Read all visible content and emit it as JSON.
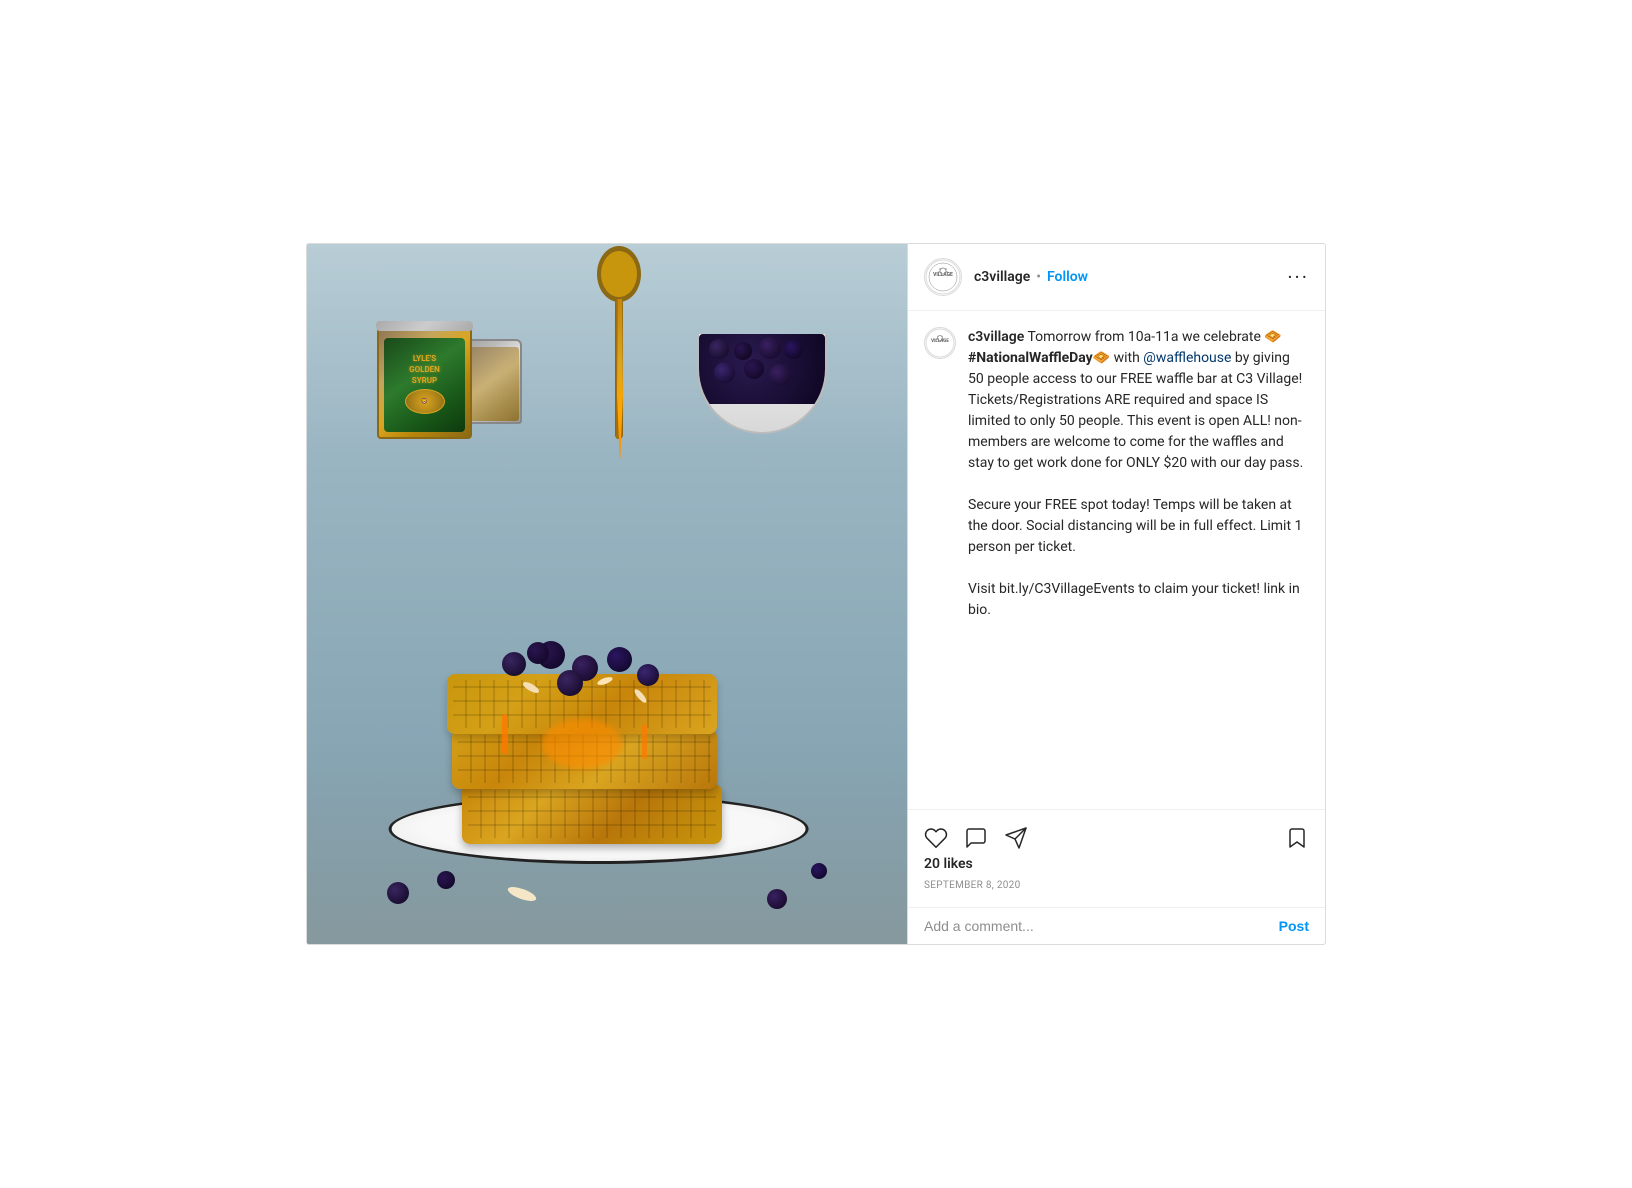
{
  "post": {
    "username": "c3village",
    "follow_label": "Follow",
    "dot_separator": "•",
    "more_icon": "•••",
    "avatar_text": "VILLAGE",
    "caption": {
      "username": "c3village",
      "text_part1": " Tomorrow from 10a-11a we celebrate 🧇#NationalWaffleDay🧇 with ",
      "mention": "@wafflehouse",
      "text_part2": " by giving 50 people access to our FREE waffle bar at C3 Village!\nTickets/Registrations ARE required and space IS limited to only 50 people. This event is open ALL! non-members are welcome to come for the waffles and stay to get work done for ONLY $20 with our day pass.\n\nSecure your FREE spot today! Temps will be taken at the door. Social distancing will be in full effect. Limit 1 person per ticket.\n\nVisit bit.ly/C3VillageEvents to claim your ticket! link in bio."
    },
    "likes": "20 likes",
    "date": "SEPTEMBER 8, 2020",
    "add_comment_placeholder": "Add a comment...",
    "post_button_label": "Post",
    "actions": {
      "like_icon": "heart",
      "comment_icon": "comment",
      "share_icon": "share",
      "bookmark_icon": "bookmark"
    }
  }
}
